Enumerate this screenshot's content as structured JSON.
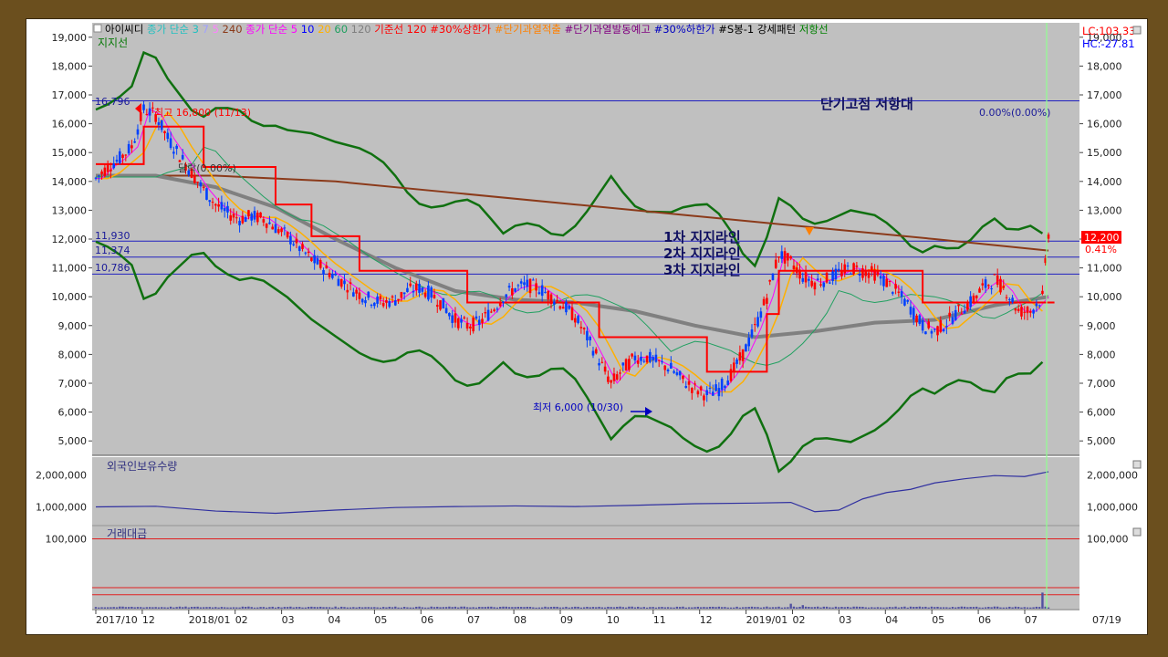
{
  "colors": {
    "frame": "#6b4f1e",
    "plot_bg": "#c0c0c0",
    "price_up": "#ff0000",
    "price_down": "#0040ff",
    "ma5": "#ff00ff",
    "ma20": "#ffb000",
    "ma60": "#20a060",
    "ma120": "#808080",
    "ma240": "#8b3a1a",
    "bollinger": "#107010",
    "support_line": "#2020c0",
    "max_price_line": "#ff0000"
  },
  "legend": {
    "items": [
      {
        "text": "아이씨디",
        "color": "#000000"
      },
      {
        "text": "종가 단순 3",
        "color": "#20c0c0"
      },
      {
        "text": "7",
        "color": "#a0a0ff"
      },
      {
        "text": "5",
        "color": "#ff80ff"
      },
      {
        "text": "240",
        "color": "#8b3a1a"
      },
      {
        "text": "종가 단순 5",
        "color": "#ff00ff"
      },
      {
        "text": "10",
        "color": "#0000ff"
      },
      {
        "text": "20",
        "color": "#ffb000"
      },
      {
        "text": "60",
        "color": "#20a060"
      },
      {
        "text": "120",
        "color": "#808080"
      },
      {
        "text": "기준선 120",
        "color": "#ff0000"
      },
      {
        "text": "#30%상한가",
        "color": "#ff0000"
      },
      {
        "text": "#단기과열적출",
        "color": "#ff8000"
      },
      {
        "text": "#단기과열발동예고",
        "color": "#800080"
      },
      {
        "text": "#30%하한가",
        "color": "#0000c0"
      },
      {
        "text": "#S봉-1 강세패턴",
        "color": "#000000"
      },
      {
        "text": "저항선",
        "color": "#008000"
      }
    ],
    "sub_label": "지지선"
  },
  "top_right": {
    "lc": "LC:103.33",
    "hc": "HC:-27.81"
  },
  "annotations": {
    "high_label": "최고 16,800 (11/13)",
    "low_label": "최저 6,000 (10/30)",
    "high_level": "16,796",
    "resist_title": "단기고점 저항대",
    "resist_pct": "0.00%(0.00%)",
    "mid_pct": "달락(0.00%)",
    "support1_value": "11,930",
    "support2_value": "11,374",
    "support3_value": "10,786",
    "support1_label": "1차 지지라인",
    "support2_label": "2차 지지라인",
    "support3_label": "3차 지지라인",
    "current_price": "12,200",
    "current_pct": "0.41%"
  },
  "panels": {
    "foreign": {
      "title": "외국인보유수량"
    },
    "volume": {
      "title": "거래대금"
    }
  },
  "chart_data": [
    {
      "type": "line",
      "title": "",
      "y_ticks": [
        "19,000",
        "18,000",
        "17,000",
        "16,000",
        "15,000",
        "14,000",
        "13,000",
        "12,000",
        "11,000",
        "10,000",
        "9,000",
        "8,000",
        "7,000",
        "6,000",
        "5,000"
      ],
      "ylim": [
        4500,
        19500
      ],
      "x_ticks": [
        "2017/10",
        "12",
        "2018/01",
        "02",
        "03",
        "04",
        "05",
        "06",
        "07",
        "08",
        "09",
        "10",
        "11",
        "12",
        "2019/01",
        "02",
        "03",
        "04",
        "05",
        "06",
        "07"
      ],
      "x_last_label": "07/19",
      "horizontal_levels": [
        {
          "name": "단기고점 저항대",
          "value": 16796
        },
        {
          "name": "1차 지지라인",
          "value": 11930
        },
        {
          "name": "2차 지지라인",
          "value": 11374
        },
        {
          "name": "3차 지지라인",
          "value": 10786
        }
      ],
      "series": [
        {
          "values": [
            [
              0,
              14100
            ],
            [
              4,
              14500
            ],
            [
              8,
              14800
            ],
            [
              12,
              15200
            ],
            [
              16,
              16500
            ],
            [
              20,
              16300
            ],
            [
              24,
              15500
            ],
            [
              28,
              14900
            ],
            [
              32,
              14300
            ],
            [
              36,
              13700
            ],
            [
              40,
              13200
            ],
            [
              44,
              12900
            ],
            [
              48,
              12700
            ],
            [
              52,
              12800
            ],
            [
              56,
              12700
            ],
            [
              60,
              12400
            ],
            [
              64,
              12100
            ],
            [
              68,
              11700
            ],
            [
              72,
              11300
            ],
            [
              76,
              11000
            ],
            [
              80,
              10700
            ],
            [
              84,
              10400
            ],
            [
              88,
              10100
            ],
            [
              92,
              9900
            ],
            [
              96,
              9800
            ],
            [
              100,
              9900
            ],
            [
              104,
              10200
            ],
            [
              108,
              10300
            ],
            [
              112,
              10100
            ],
            [
              116,
              9700
            ],
            [
              120,
              9200
            ],
            [
              124,
              9000
            ],
            [
              128,
              9100
            ],
            [
              132,
              9500
            ],
            [
              136,
              10000
            ],
            [
              140,
              10300
            ],
            [
              144,
              10400
            ],
            [
              148,
              10300
            ],
            [
              152,
              10000
            ],
            [
              156,
              9700
            ],
            [
              160,
              9300
            ],
            [
              164,
              8600
            ],
            [
              168,
              7800
            ],
            [
              172,
              7000
            ],
            [
              176,
              7500
            ],
            [
              180,
              7900
            ],
            [
              184,
              7900
            ],
            [
              188,
              7700
            ],
            [
              192,
              7500
            ],
            [
              196,
              7100
            ],
            [
              200,
              6800
            ],
            [
              204,
              6600
            ],
            [
              208,
              6800
            ],
            [
              212,
              7300
            ],
            [
              216,
              8000
            ],
            [
              220,
              8900
            ],
            [
              224,
              10000
            ],
            [
              228,
              11500
            ],
            [
              232,
              11200
            ],
            [
              236,
              10700
            ],
            [
              240,
              10500
            ],
            [
              244,
              10600
            ],
            [
              248,
              10800
            ],
            [
              252,
              11000
            ],
            [
              256,
              10900
            ],
            [
              260,
              10800
            ],
            [
              264,
              10500
            ],
            [
              268,
              10100
            ],
            [
              272,
              9600
            ],
            [
              276,
              9000
            ],
            [
              280,
              8800
            ],
            [
              284,
              9100
            ],
            [
              288,
              9500
            ],
            [
              292,
              9800
            ],
            [
              296,
              10300
            ],
            [
              300,
              10600
            ],
            [
              304,
              10200
            ],
            [
              308,
              9500
            ],
            [
              312,
              9500
            ],
            [
              316,
              10000
            ],
            [
              318,
              12200
            ]
          ]
        },
        {
          "values": [
            [
              0,
              14200
            ],
            [
              20,
              14200
            ],
            [
              40,
              13800
            ],
            [
              60,
              13100
            ],
            [
              80,
              12000
            ],
            [
              100,
              11000
            ],
            [
              120,
              10200
            ],
            [
              140,
              9900
            ],
            [
              160,
              9800
            ],
            [
              180,
              9500
            ],
            [
              200,
              9000
            ],
            [
              220,
              8600
            ],
            [
              240,
              8800
            ],
            [
              260,
              9100
            ],
            [
              280,
              9200
            ],
            [
              300,
              9700
            ],
            [
              318,
              10000
            ]
          ]
        },
        {
          "values": [
            [
              0,
              14200
            ],
            [
              40,
              14200
            ],
            [
              80,
              14000
            ],
            [
              120,
              13600
            ],
            [
              160,
              13200
            ],
            [
              200,
              12800
            ],
            [
              240,
              12400
            ],
            [
              280,
              12000
            ],
            [
              318,
              11600
            ]
          ]
        }
      ]
    },
    {
      "type": "line",
      "title": "외국인보유수량",
      "y_ticks": [
        "2,000,000",
        "1,000,000"
      ],
      "ylim": [
        500000,
        2500000
      ],
      "series": [
        {
          "values": [
            [
              0,
              1000000
            ],
            [
              20,
              1020000
            ],
            [
              40,
              870000
            ],
            [
              60,
              800000
            ],
            [
              80,
              900000
            ],
            [
              100,
              980000
            ],
            [
              120,
              1010000
            ],
            [
              140,
              1030000
            ],
            [
              160,
              1010000
            ],
            [
              180,
              1050000
            ],
            [
              200,
              1100000
            ],
            [
              220,
              1120000
            ],
            [
              232,
              1140000
            ],
            [
              240,
              850000
            ],
            [
              248,
              900000
            ],
            [
              256,
              1250000
            ],
            [
              264,
              1450000
            ],
            [
              272,
              1550000
            ],
            [
              280,
              1750000
            ],
            [
              290,
              1880000
            ],
            [
              300,
              1980000
            ],
            [
              310,
              1950000
            ],
            [
              318,
              2100000
            ]
          ]
        }
      ]
    },
    {
      "type": "bar",
      "title": "거래대금",
      "y_ticks": [
        "100,000"
      ],
      "ylim": [
        0,
        115000
      ],
      "reference_lines": [
        100000,
        30000,
        20000
      ],
      "values_note_indices": [
        [
          232,
          7000
        ],
        [
          236,
          5000
        ],
        [
          300,
          3000
        ],
        [
          316,
          23000
        ]
      ]
    }
  ]
}
